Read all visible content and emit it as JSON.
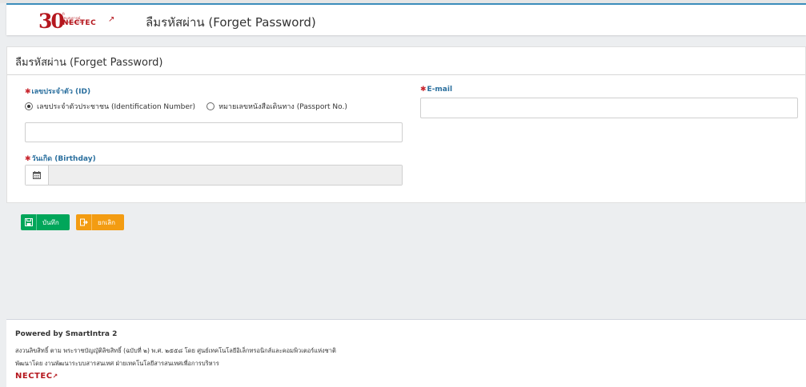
{
  "header": {
    "logo_text": "NECTEC",
    "logo_number": "30",
    "title": "ลืมรหัสผ่าน (Forget Password)"
  },
  "form": {
    "panel_title": "ลืมรหัสผ่าน (Forget Password)",
    "id_label": "เลขประจำตัว (ID)",
    "id_options": [
      {
        "label": "เลขประจำตัวประชาชน (Identification Number)",
        "checked": true
      },
      {
        "label": "หมายเลขหนังสือเดินทาง (Passport No.)",
        "checked": false
      }
    ],
    "id_value": "",
    "birthday_label": "วันเกิด (Birthday)",
    "birthday_value": "",
    "email_label": "E-mail",
    "email_value": "",
    "required_mark": "✱"
  },
  "actions": {
    "save_label": "บันทึก",
    "cancel_label": "ยกเลิก",
    "save_color": "#00a65a",
    "cancel_color": "#f39c12"
  },
  "footer": {
    "powered": "Powered by SmartIntra 2",
    "copyright": "สงวนลิขสิทธิ์ ตาม พระราชบัญญัติลิขสิทธิ์ (ฉบับที่ ๒) พ.ศ. ๒๕๕๘ โดย ศูนย์เทคโนโลยีอิเล็กทรอนิกส์และคอมพิวเตอร์แห่งชาติ",
    "developer": "พัฒนาโดย งานพัฒนาระบบสารสนเทศ ฝ่ายเทคโนโลยีสารสนเทศเพื่อการบริหาร",
    "logo_text": "NECTEC"
  },
  "icons": {
    "calendar": "calendar-icon",
    "save": "floppy-disk-icon",
    "cancel": "sign-out-icon"
  },
  "colors": {
    "accent": "#3c8dbc",
    "label": "#2a6f9e",
    "required": "#c8262e",
    "brand": "#b5171e"
  }
}
